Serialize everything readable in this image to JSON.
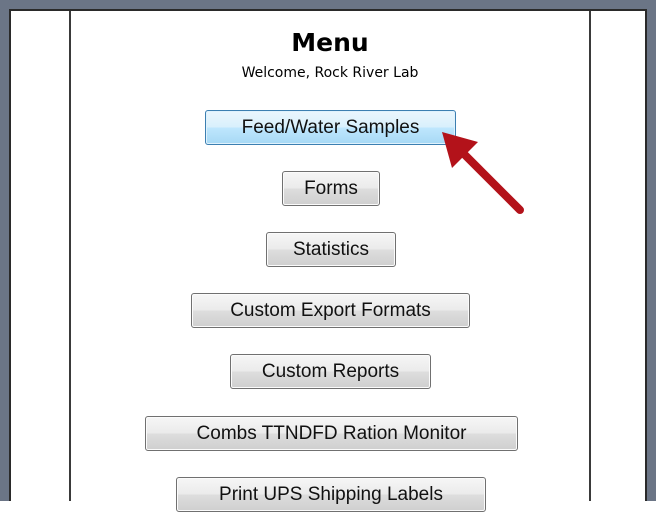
{
  "menu": {
    "title": "Menu",
    "welcome": "Welcome, Rock River Lab"
  },
  "buttons": {
    "feed_water": "Feed/Water Samples",
    "forms": "Forms",
    "statistics": "Statistics",
    "custom_export": "Custom Export Formats",
    "custom_reports": "Custom Reports",
    "combs_ttndfd": "Combs TTNDFD Ration Monitor",
    "print_ups": "Print UPS Shipping Labels"
  },
  "colors": {
    "frame": "#6b7586",
    "arrow": "#b3121a",
    "focused_button_border": "#3c7fb1"
  },
  "icons": {
    "pointer": "red-arrow-icon"
  }
}
